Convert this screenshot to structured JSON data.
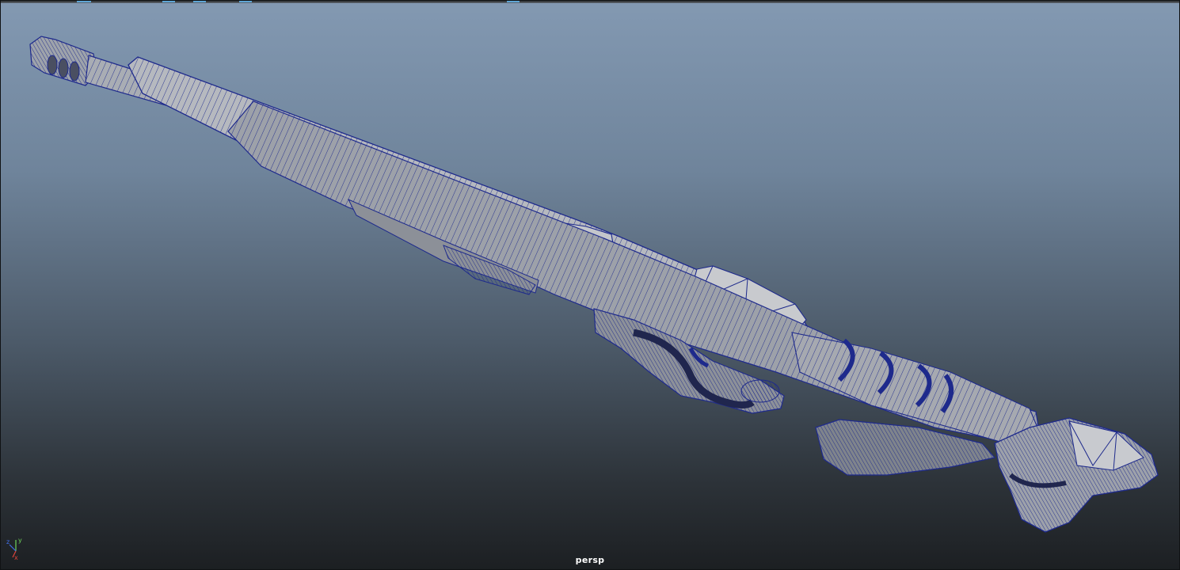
{
  "viewport": {
    "camera": "persp",
    "axis": {
      "x_label": "x",
      "y_label": "y",
      "z_label": "z",
      "x_color": "#e0443c",
      "y_color": "#6ed35a",
      "z_color": "#3f6ee8"
    },
    "background_top": "#8399b2",
    "background_bottom": "#1c1f22",
    "wireframe_color": "#1e2a8c",
    "shaded_color": "#a8aab0"
  },
  "model": {
    "name_icon": "rifle-mesh",
    "display_mode": "wireframe-on-shaded"
  }
}
